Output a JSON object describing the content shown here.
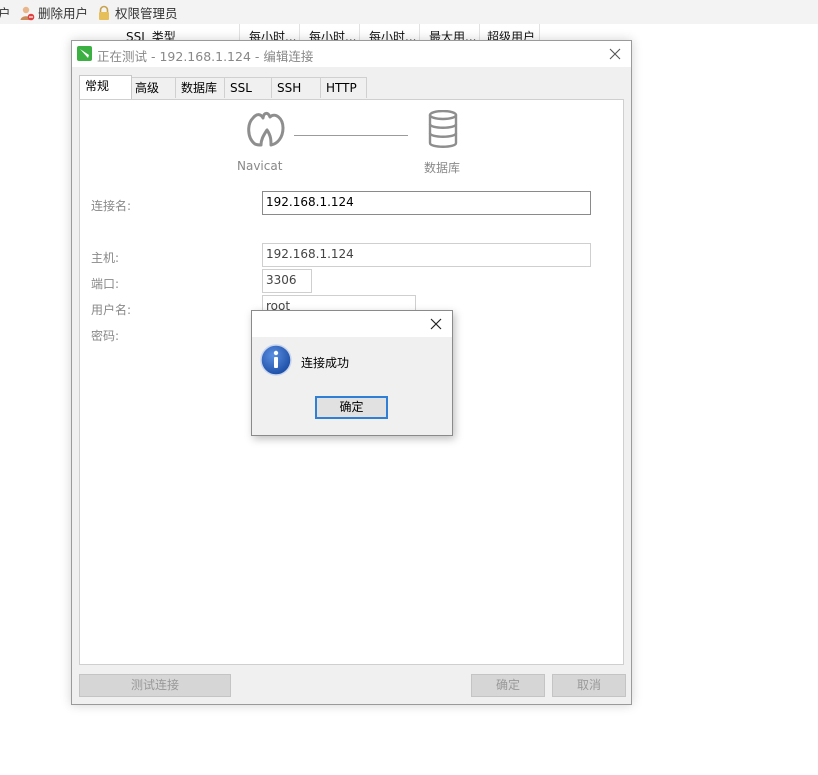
{
  "background_toolbar": {
    "partial_label": "户",
    "delete_user": "删除用户",
    "privilege_admin": "权限管理员"
  },
  "background_columns": [
    "SSL 类型",
    "每小时...",
    "每小时...",
    "每小时...",
    "最大用...",
    "超级用户"
  ],
  "dialog": {
    "title": "正在测试 - 192.168.1.124 - 编辑连接",
    "tabs": [
      "常规",
      "高级",
      "数据库",
      "SSL",
      "SSH",
      "HTTP"
    ],
    "active_tab": "常规",
    "navicat_label": "Navicat",
    "database_label": "数据库",
    "connection_name_label": "连接名:",
    "connection_name_value": "192.168.1.124",
    "host_label": "主机:",
    "host_value": "192.168.1.124",
    "port_label": "端口:",
    "port_value": "3306",
    "username_label": "用户名:",
    "username_value": "root",
    "password_label": "密码:",
    "test_button": "测试连接",
    "ok_button": "确定",
    "cancel_button": "取消"
  },
  "message_box": {
    "message": "连接成功",
    "ok_button": "确定"
  },
  "colors": {
    "info_icon": "#1e4fa8",
    "focus_border": "#2f7fd7",
    "navicat_green": "#3cb043"
  }
}
